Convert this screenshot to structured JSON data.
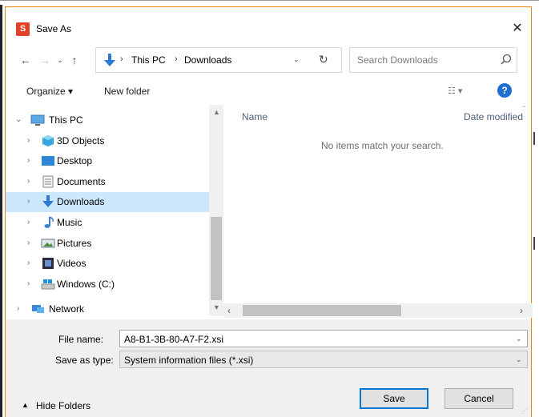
{
  "window": {
    "title": "Save As",
    "app_icon_label": "S",
    "close_glyph": "✕"
  },
  "nav": {
    "back_glyph": "←",
    "forward_glyph": "→",
    "recent_glyph": "⌄",
    "up_glyph": "↑"
  },
  "address": {
    "crumbs": [
      "This PC",
      "Downloads"
    ],
    "separator": "›",
    "dropdown_glyph": "⌄",
    "refresh_glyph": "↻"
  },
  "search": {
    "placeholder": "Search Downloads"
  },
  "commandbar": {
    "organize_label": "Organize ▾",
    "new_folder_label": "New folder",
    "view_label": "☷ ▾",
    "help_label": "?"
  },
  "tree": {
    "items": [
      {
        "label": "This PC",
        "icon": "this-pc-icon",
        "expanded": true
      },
      {
        "label": "3D Objects",
        "icon": "3d-objects-icon"
      },
      {
        "label": "Desktop",
        "icon": "desktop-icon"
      },
      {
        "label": "Documents",
        "icon": "documents-icon"
      },
      {
        "label": "Downloads",
        "icon": "downloads-icon",
        "selected": true
      },
      {
        "label": "Music",
        "icon": "music-icon"
      },
      {
        "label": "Pictures",
        "icon": "pictures-icon"
      },
      {
        "label": "Videos",
        "icon": "videos-icon"
      },
      {
        "label": "Windows (C:)",
        "icon": "drive-icon"
      },
      {
        "label": "Network",
        "icon": "network-icon"
      }
    ],
    "chevron_collapsed": "›",
    "chevron_expanded": "⌄"
  },
  "content": {
    "columns": [
      "Name",
      "Date modified"
    ],
    "empty_message": "No items match your search."
  },
  "form": {
    "file_name_label": "File name:",
    "file_name_value": "A8-B1-3B-80-A7-F2.xsi",
    "save_type_label": "Save as type:",
    "save_type_value": "System information files (*.xsi)",
    "dropdown_glyph": "⌄"
  },
  "footer": {
    "hide_folders_label": "Hide Folders",
    "save_label": "Save",
    "cancel_label": "Cancel"
  },
  "colors": {
    "accent": "#0078d7",
    "selection": "#cce8ff",
    "dialog_border": "#e8850c"
  }
}
